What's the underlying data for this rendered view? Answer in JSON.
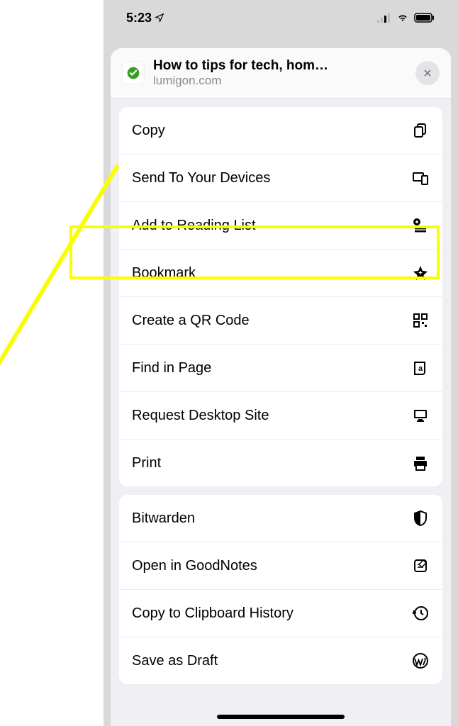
{
  "status": {
    "time": "5:23"
  },
  "header": {
    "title": "How to tips for tech, hom…",
    "url": "lumigon.com"
  },
  "section1": [
    {
      "label": "Copy",
      "icon": "copy-icon"
    },
    {
      "label": "Send To Your Devices",
      "icon": "devices-icon"
    },
    {
      "label": "Add to Reading List",
      "icon": "reading-list-icon"
    },
    {
      "label": "Bookmark",
      "icon": "star-icon"
    },
    {
      "label": "Create a QR Code",
      "icon": "qr-icon"
    },
    {
      "label": "Find in Page",
      "icon": "find-icon"
    },
    {
      "label": "Request Desktop Site",
      "icon": "desktop-icon"
    },
    {
      "label": "Print",
      "icon": "print-icon"
    }
  ],
  "section2": [
    {
      "label": "Bitwarden",
      "icon": "shield-icon"
    },
    {
      "label": "Open in GoodNotes",
      "icon": "note-icon"
    },
    {
      "label": "Copy to Clipboard History",
      "icon": "clock-icon"
    },
    {
      "label": "Save as Draft",
      "icon": "wp-icon"
    }
  ]
}
